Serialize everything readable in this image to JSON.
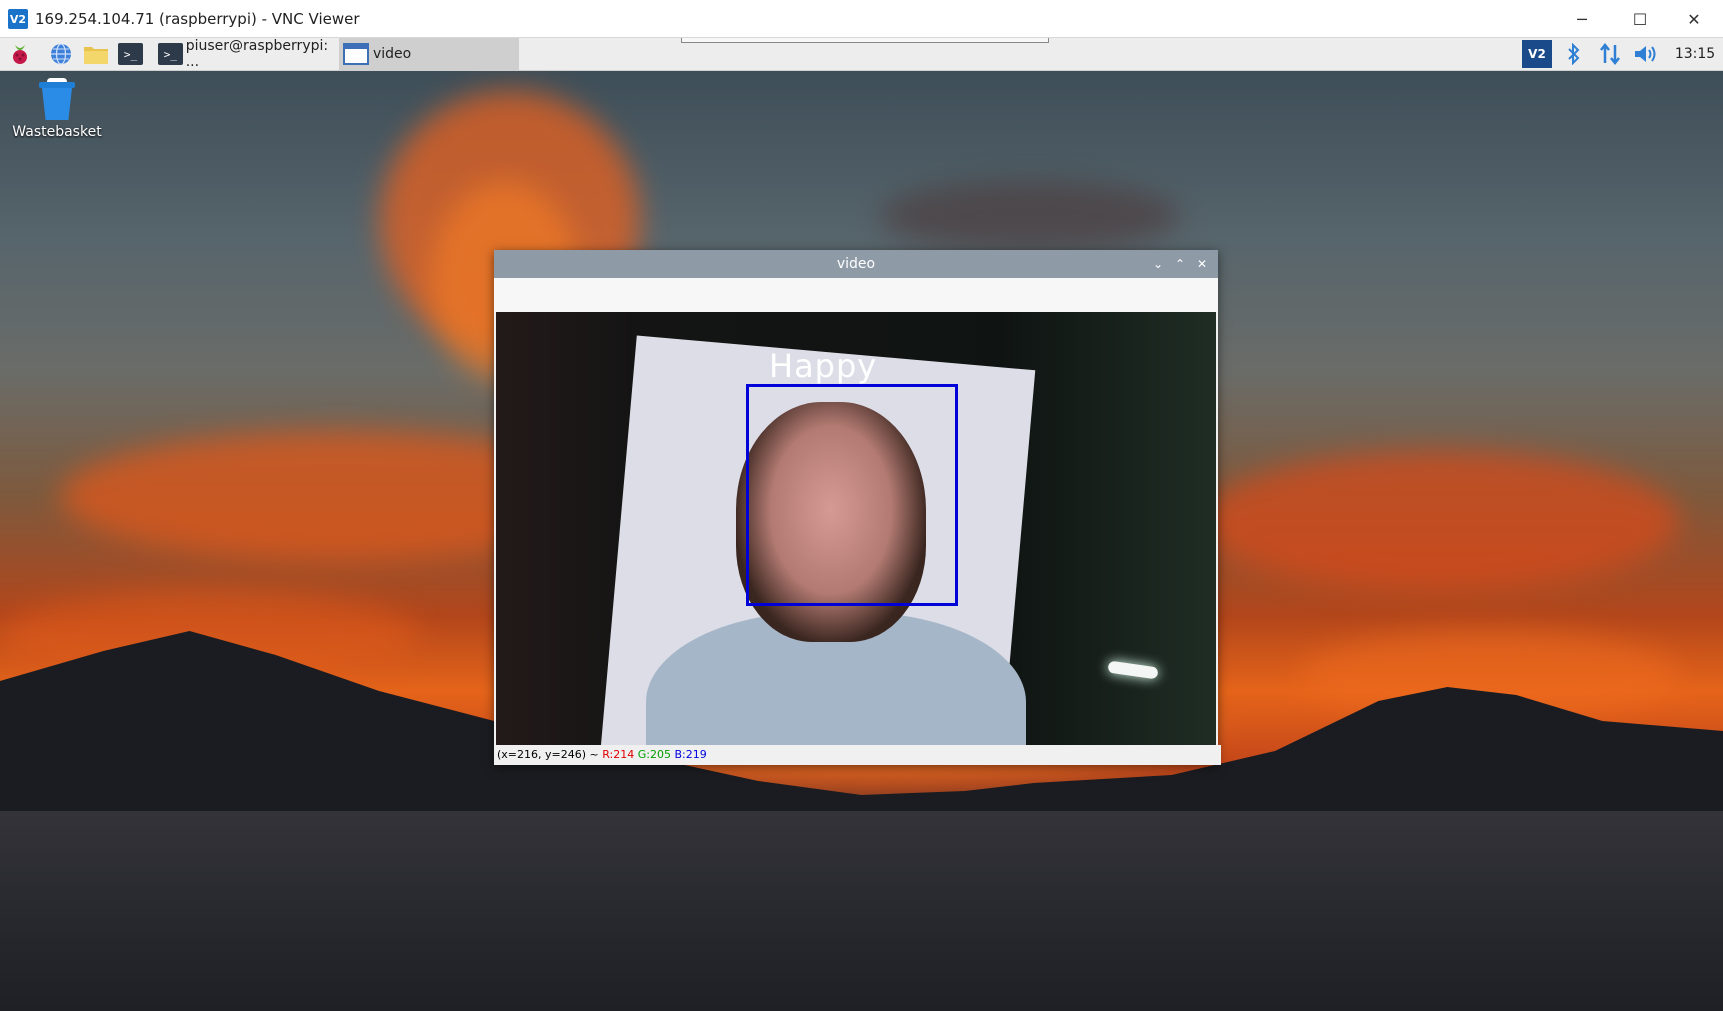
{
  "vnc": {
    "logo": "V2",
    "title": "169.254.104.71 (raspberrypi) - VNC Viewer",
    "controls": {
      "minimize": "─",
      "maximize": "☐",
      "close": "✕"
    }
  },
  "taskbar": {
    "launchers": [
      {
        "name": "raspberry-menu-icon"
      },
      {
        "name": "web-browser-icon"
      },
      {
        "name": "file-manager-icon"
      },
      {
        "name": "terminal-icon",
        "glyph": ">_"
      }
    ],
    "tasks": [
      {
        "label": "piuser@raspberrypi: ...",
        "glyph": ">_",
        "active": false
      },
      {
        "label": "video",
        "active": true
      }
    ],
    "tray": {
      "vnc_icon": "V2",
      "bluetooth_icon": "bluetooth-icon",
      "network_icon": "network-icon",
      "volume_icon": "volume-icon",
      "clock": "13:15"
    }
  },
  "desktop": {
    "icons": [
      {
        "label": "Wastebasket",
        "icon": "wastebasket-icon"
      }
    ]
  },
  "video_window": {
    "title": "video",
    "controls": {
      "minimize": "⌄",
      "maximize": "⌃",
      "close": "✕"
    },
    "detection": {
      "emotion": "Happy",
      "box_color": "#0000d8"
    },
    "status": {
      "coords": "(x=216, y=246) ~",
      "r": "R:214",
      "g": "G:205",
      "b": "B:219"
    }
  }
}
